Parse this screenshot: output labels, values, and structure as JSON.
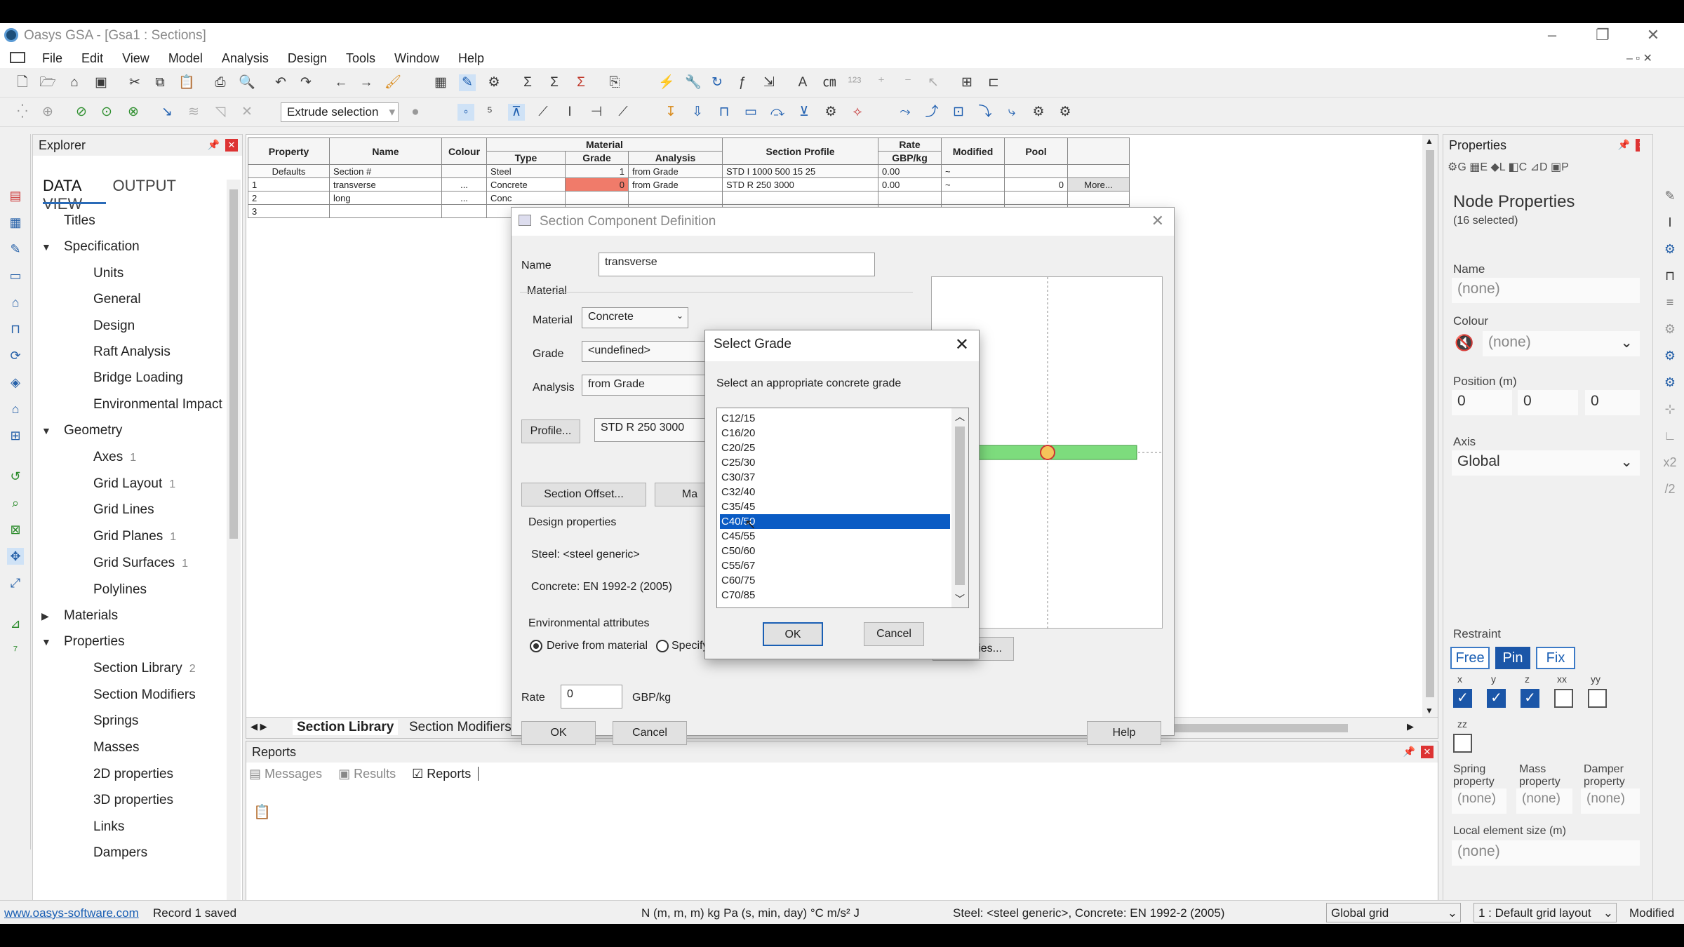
{
  "window": {
    "title": "Oasys GSA - [Gsa1 : Sections]"
  },
  "menu": [
    "File",
    "Edit",
    "View",
    "Model",
    "Analysis",
    "Design",
    "Tools",
    "Window",
    "Help"
  ],
  "toolbar": {
    "extrude_label": "Extrude selection"
  },
  "explorer": {
    "title": "Explorer",
    "tabs": [
      "DATA",
      "OUTPUT",
      "VIEW"
    ],
    "tree": [
      {
        "label": "Titles",
        "count": ""
      },
      {
        "label": "Specification",
        "count": ""
      },
      {
        "label": "Units",
        "count": ""
      },
      {
        "label": "General",
        "count": ""
      },
      {
        "label": "Design",
        "count": ""
      },
      {
        "label": "Raft Analysis",
        "count": ""
      },
      {
        "label": "Bridge Loading",
        "count": ""
      },
      {
        "label": "Environmental Impact",
        "count": ""
      },
      {
        "label": "Geometry",
        "count": ""
      },
      {
        "label": "Axes",
        "count": "1"
      },
      {
        "label": "Grid Layout",
        "count": "1"
      },
      {
        "label": "Grid Lines",
        "count": ""
      },
      {
        "label": "Grid Planes",
        "count": "1"
      },
      {
        "label": "Grid Surfaces",
        "count": "1"
      },
      {
        "label": "Polylines",
        "count": ""
      },
      {
        "label": "Materials",
        "count": ""
      },
      {
        "label": "Properties",
        "count": ""
      },
      {
        "label": "Section Library",
        "count": "2"
      },
      {
        "label": "Section Modifiers",
        "count": ""
      },
      {
        "label": "Springs",
        "count": ""
      },
      {
        "label": "Masses",
        "count": ""
      },
      {
        "label": "2D properties",
        "count": ""
      },
      {
        "label": "3D properties",
        "count": ""
      },
      {
        "label": "Links",
        "count": ""
      },
      {
        "label": "Dampers",
        "count": ""
      }
    ]
  },
  "grid": {
    "headers": {
      "property": "Property",
      "name": "Name",
      "colour": "Colour",
      "material": "Material",
      "type": "Type",
      "grade": "Grade",
      "analysis": "Analysis",
      "profile": "Section Profile",
      "rate": "Rate",
      "rate_unit": "GBP/kg",
      "modified": "Modified",
      "pool": "Pool"
    },
    "rows": [
      [
        "Defaults",
        "Section #",
        "",
        "Steel",
        "1",
        "from Grade",
        "STD I 1000 500 15 25",
        "0.00",
        "~",
        "",
        ""
      ],
      [
        "1",
        "transverse",
        "...",
        "Concrete",
        "0",
        "from Grade",
        "STD R 250 3000",
        "0.00",
        "~",
        "0",
        "More..."
      ],
      [
        "2",
        "long",
        "...",
        "Conc",
        "",
        "",
        "",
        "",
        "",
        "",
        ""
      ],
      [
        "3",
        "",
        "",
        "",
        "",
        "",
        "",
        "",
        "",
        "",
        ""
      ]
    ],
    "sheet_tabs": [
      "Section Library",
      "Section Modifiers"
    ]
  },
  "reports": {
    "title": "Reports",
    "tabs": [
      "Messages",
      "Results",
      "Reports"
    ]
  },
  "properties": {
    "title": "Properties",
    "heading": "Node Properties",
    "sub": "(16 selected)",
    "name_label": "Name",
    "name_value": "(none)",
    "colour_label": "Colour",
    "colour_value": "(none)",
    "position_label": "Position (m)",
    "position": [
      "0",
      "0",
      "0"
    ],
    "axis_label": "Axis",
    "axis_value": "Global",
    "restraint_label": "Restraint",
    "restraint_btns": [
      "Free",
      "Pin",
      "Fix"
    ],
    "restraint_axes": [
      "x",
      "y",
      "z",
      "xx",
      "yy",
      "zz"
    ],
    "restraint_checked": [
      true,
      true,
      true,
      false,
      false,
      false
    ],
    "spring_label": "Spring property",
    "mass_label": "Mass property",
    "damper_label": "Damper property",
    "spring_value": "(none)",
    "mass_value": "(none)",
    "damper_value": "(none)",
    "local_size_label": "Local element size (m)",
    "local_size_value": "(none)"
  },
  "status": {
    "link": "www.oasys-software.com",
    "saved": "Record 1 saved",
    "units": "N  (m, m, m)  kg  Pa  (s, min, day)  °C  m/s²  J",
    "design": "Steel: <steel generic>, Concrete: EN 1992-2 (2005)",
    "grid": "Global grid",
    "layout": "1 : Default grid layout",
    "modified": "Modified"
  },
  "section_dialog": {
    "title": "Section Component Definition",
    "name_label": "Name",
    "name_value": "transverse",
    "material_group": "Material",
    "material_label": "Material",
    "material_value": "Concrete",
    "grade_label": "Grade",
    "grade_value": "<undefined>",
    "analysis_label": "Analysis",
    "analysis_value": "from Grade",
    "profile_btn": "Profile...",
    "profile_value": "STD R 250 3000",
    "offset_btn": "Section Offset...",
    "ma_btn": "Ma",
    "design_props": "Design properties",
    "steel": "Steel: <steel generic>",
    "concrete": "Concrete: EN 1992-2 (2005)",
    "env_attrs": "Environmental attributes",
    "derive": "Derive from material",
    "specify": "Specify",
    "props_btn": "ies...",
    "rate_label": "Rate",
    "rate_value": "0",
    "rate_unit": "GBP/kg",
    "ok": "OK",
    "cancel": "Cancel",
    "help": "Help"
  },
  "grade_dialog": {
    "title": "Select Grade",
    "prompt": "Select an appropriate concrete grade",
    "grades": [
      "C12/15",
      "C16/20",
      "C20/25",
      "C25/30",
      "C30/37",
      "C32/40",
      "C35/45",
      "C40/50",
      "C45/55",
      "C50/60",
      "C55/67",
      "C60/75",
      "C70/85"
    ],
    "selected_index": 7,
    "ok": "OK",
    "cancel": "Cancel"
  },
  "colors": {
    "accent": "#0a5bc4",
    "grade_cell": "#f07b6a",
    "section_green": "#7ddc7d"
  }
}
